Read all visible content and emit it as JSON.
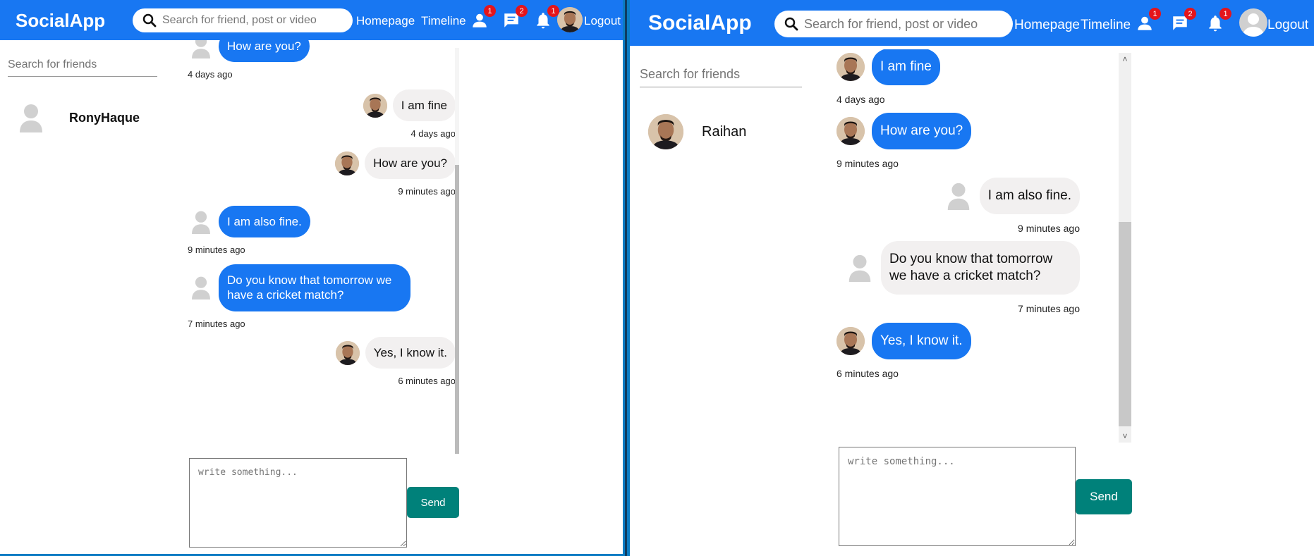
{
  "app": {
    "logo": "SocialApp",
    "search_placeholder": "Search for friend, post or video",
    "nav_homepage": "Homepage",
    "nav_timeline": "Timeline",
    "nav_logout": "Logout",
    "badge_friends": "1",
    "badge_messages": "2",
    "badge_notifications": "1",
    "brand_color": "#1877f2",
    "send_color": "#00817a"
  },
  "left_window": {
    "friend_search_placeholder": "Search for friends",
    "friend_name": "RonyHaque",
    "messages": [
      {
        "text": "How are you?",
        "time": "4 days ago",
        "side": "left",
        "style": "blue"
      },
      {
        "text": "I am fine",
        "time": "4 days ago",
        "side": "right",
        "style": "grey"
      },
      {
        "text": "How are you?",
        "time": "9 minutes ago",
        "side": "right",
        "style": "grey"
      },
      {
        "text": "I am also fine.",
        "time": "9 minutes ago",
        "side": "left",
        "style": "blue"
      },
      {
        "text": "Do you know that tomorrow we have a cricket match?",
        "time": "7 minutes ago",
        "side": "left",
        "style": "blue"
      },
      {
        "text": "Yes, I know it.",
        "time": "6 minutes ago",
        "side": "right",
        "style": "grey"
      }
    ],
    "composer_placeholder": "write something...",
    "send_label": "Send"
  },
  "right_window": {
    "friend_search_placeholder": "Search for friends",
    "friend_name": "Raihan",
    "messages": [
      {
        "text": "I am fine",
        "time": "4 days ago",
        "side": "left",
        "style": "blue"
      },
      {
        "text": "How are you?",
        "time": "9 minutes ago",
        "side": "left",
        "style": "blue"
      },
      {
        "text": "I am also fine.",
        "time": "9 minutes ago",
        "side": "right",
        "style": "grey"
      },
      {
        "text": "Do you know that tomorrow we have a cricket match?",
        "time": "7 minutes ago",
        "side": "right",
        "style": "grey"
      },
      {
        "text": "Yes, I know it.",
        "time": "6 minutes ago",
        "side": "left",
        "style": "blue"
      }
    ],
    "composer_placeholder": "write something...",
    "send_label": "Send"
  }
}
